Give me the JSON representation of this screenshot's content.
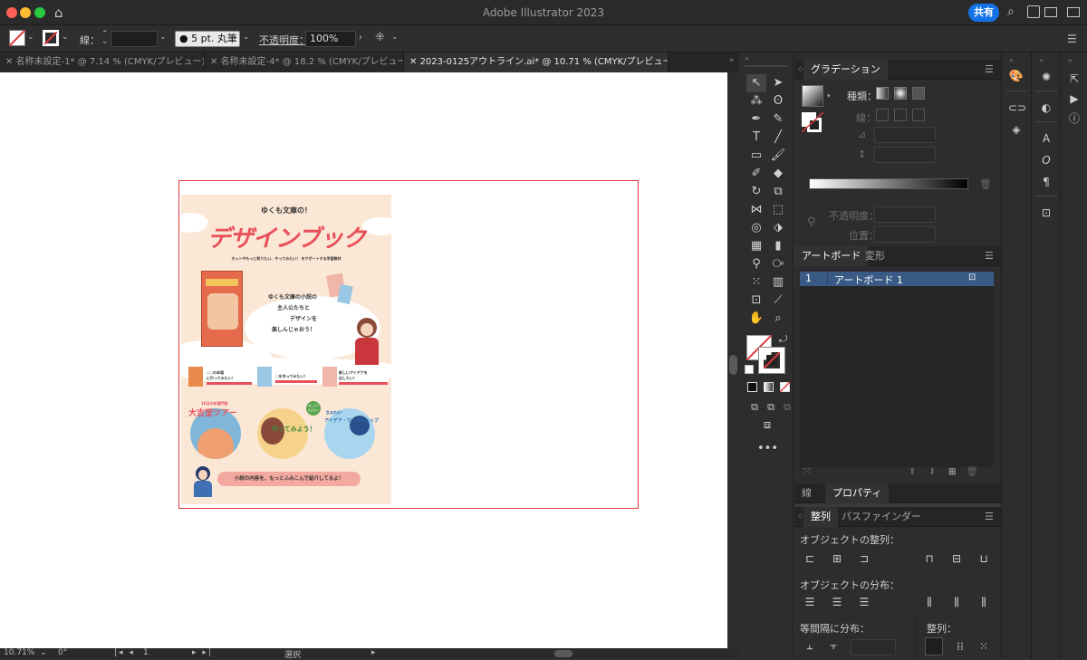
{
  "window": {
    "title": "Adobe Illustrator 2023",
    "share_label": "共有",
    "traffic_colors": [
      "#fe5f57",
      "#febc2e",
      "#28c840"
    ]
  },
  "control_bar": {
    "stroke_label": "線：",
    "brush_value": "5 pt. 丸筆",
    "opacity_label": "不透明度：",
    "opacity_value": "100%"
  },
  "tabs": [
    {
      "label": "名称未設定-1* @ 7.14 % (CMYK/プレビュー)"
    },
    {
      "label": "名称未設定-4* @ 18.2 % (CMYK/プレビュー)"
    },
    {
      "label": "2023-0125アウトライン.ai* @ 10.71 % (CMYK/プレビュー)"
    }
  ],
  "status_bar": {
    "zoom": "10.71%",
    "rotation": "0°",
    "artboard_number": "1",
    "mode": "選択"
  },
  "flyer": {
    "kicker": "ゆくも文庫の！",
    "title": "デザインブック",
    "subtitle": "ネットやもっと知りたい、やってみたい！ をサポートする学習教材",
    "bubble_lines": [
      "ゆくも文庫の小説の",
      "主人公たちと",
      "デザインを",
      "楽しんじゃおう！"
    ],
    "ribbons": [
      "○○の本場\nに行ってみたい！",
      "○を作ってみたい！",
      "新しいアイデアを\n出したい！"
    ],
    "circle1_label": "大吉堂ツアー",
    "circle1_kicker": "16日の本場門前",
    "circle2_label": "作ってみよう！",
    "circle2_badge": "おしえて\nせんせい",
    "circle3_label": "アイデア・ワークショップ",
    "circle3_kicker": "生まれた！",
    "footer": "小説の内容を、もっとふみこんで紹介してるよ！"
  },
  "gradient_panel": {
    "title": "グラデーション",
    "type_label": "種類：",
    "stroke_label": "線：",
    "opacity_label": "不透明度：",
    "position_label": "位置："
  },
  "artboard_panel": {
    "tabs": [
      "アートボード",
      "変形"
    ],
    "rows": [
      {
        "number": "1",
        "name": "アートボード 1"
      }
    ]
  },
  "properties_panel": {
    "tabs": [
      "線",
      "プロパティ"
    ]
  },
  "align_panel": {
    "tabs": [
      "整列",
      "パスファインダー"
    ],
    "align_objects": "オブジェクトの整列：",
    "distribute_objects": "オブジェクトの分布：",
    "distribute_spacing": "等間隔に分布：",
    "align_to": "整列："
  }
}
